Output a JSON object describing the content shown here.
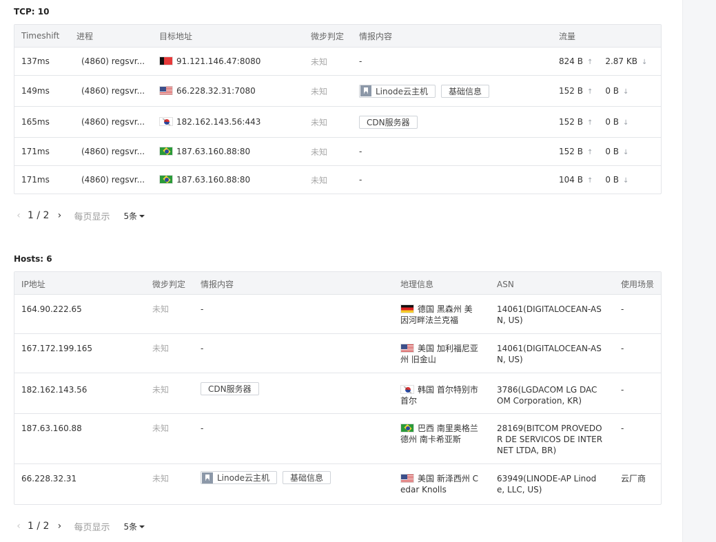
{
  "tcp": {
    "title": "TCP:  10",
    "headers": [
      "Timeshift",
      "进程",
      "目标地址",
      "微步判定",
      "情报内容",
      "流量"
    ],
    "rows": [
      {
        "time": "137ms",
        "proc": "(4860) regsvr...",
        "flag": "be",
        "addr": "91.121.146.47:8080",
        "verdict": "未知",
        "intel": "-",
        "up": "824 B",
        "down": "2.87 KB"
      },
      {
        "time": "149ms",
        "proc": "(4860) regsvr...",
        "flag": "us",
        "addr": "66.228.32.31:7080",
        "verdict": "未知",
        "tag1": "Linode云主机",
        "tag2": "基础信息",
        "up": "152 B",
        "down": "0 B"
      },
      {
        "time": "165ms",
        "proc": "(4860) regsvr...",
        "flag": "kr",
        "addr": "182.162.143.56:443",
        "verdict": "未知",
        "tag1": "CDN服务器",
        "up": "152 B",
        "down": "0 B"
      },
      {
        "time": "171ms",
        "proc": "(4860) regsvr...",
        "flag": "br",
        "addr": "187.63.160.88:80",
        "verdict": "未知",
        "intel": "-",
        "up": "152 B",
        "down": "0 B"
      },
      {
        "time": "171ms",
        "proc": "(4860) regsvr...",
        "flag": "br",
        "addr": "187.63.160.88:80",
        "verdict": "未知",
        "intel": "-",
        "up": "104 B",
        "down": "0 B"
      }
    ],
    "pager": {
      "page": "1 / 2",
      "per_page_label": "每页显示",
      "size": "5条"
    }
  },
  "hosts": {
    "title": "Hosts:  6",
    "headers": [
      "IP地址",
      "微步判定",
      "情报内容",
      "地理信息",
      "ASN",
      "使用场景"
    ],
    "rows": [
      {
        "ip": "164.90.222.65",
        "verdict": "未知",
        "intel": "-",
        "flag": "de",
        "geo": "德国 黑森州 美因河畔法兰克福",
        "asn": "14061(DIGITALOCEAN-ASN, US)",
        "scene": "-"
      },
      {
        "ip": "167.172.199.165",
        "verdict": "未知",
        "intel": "-",
        "flag": "us",
        "geo": "美国 加利福尼亚州 旧金山",
        "asn": "14061(DIGITALOCEAN-ASN, US)",
        "scene": "-"
      },
      {
        "ip": "182.162.143.56",
        "verdict": "未知",
        "tag1": "CDN服务器",
        "flag": "kr",
        "geo": "韩国 首尔特别市首尔",
        "asn": "3786(LGDACOM LG DACOM Corporation, KR)",
        "scene": "-"
      },
      {
        "ip": "187.63.160.88",
        "verdict": "未知",
        "intel": "-",
        "flag": "br",
        "geo": "巴西 南里奥格兰德州 南卡希亚斯",
        "asn": "28169(BITCOM PROVEDOR DE SERVICOS DE INTERNET LTDA, BR)",
        "scene": "-"
      },
      {
        "ip": "66.228.32.31",
        "verdict": "未知",
        "tag1": "Linode云主机",
        "tag2": "基础信息",
        "flag": "us",
        "geo": "美国 新泽西州 Cedar Knolls",
        "asn": "63949(LINODE-AP Linode, LLC, US)",
        "scene": "云厂商"
      }
    ],
    "pager": {
      "page": "1 / 2",
      "per_page_label": "每页显示",
      "size": "5条"
    }
  },
  "icons": {
    "prev": "chevron-left-icon",
    "next": "chevron-right-icon",
    "up": "arrow-up-icon",
    "down": "arrow-down-icon",
    "tag": "bookmark-icon"
  }
}
